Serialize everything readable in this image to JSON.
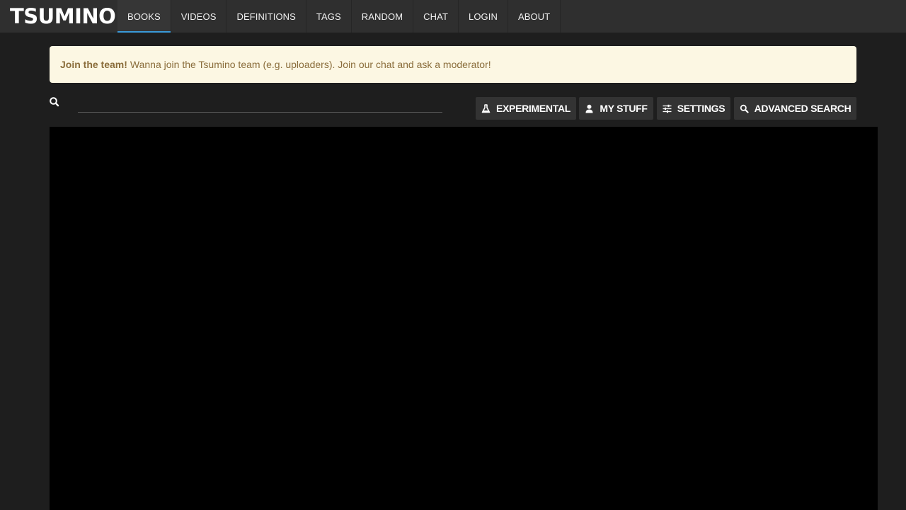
{
  "brand": "TSUMINO",
  "nav": {
    "items": [
      {
        "label": "BOOKS",
        "active": true
      },
      {
        "label": "VIDEOS"
      },
      {
        "label": "DEFINITIONS"
      },
      {
        "label": "TAGS"
      },
      {
        "label": "RANDOM"
      },
      {
        "label": "CHAT"
      },
      {
        "label": "LOGIN"
      },
      {
        "label": "ABOUT"
      }
    ]
  },
  "alert": {
    "title": "Join the team!",
    "message": "Wanna join the Tsumino team (e.g. uploaders). Join our chat and ask a moderator!"
  },
  "search": {
    "icon": "search-icon",
    "value": "",
    "placeholder": ""
  },
  "toolbar": {
    "experimental": {
      "label": "EXPERIMENTAL",
      "icon": "flask-icon"
    },
    "my_stuff": {
      "label": "MY STUFF",
      "icon": "user-icon"
    },
    "settings": {
      "label": "SETTINGS",
      "icon": "sliders-icon"
    },
    "advanced_search": {
      "label": "ADVANCED SEARCH",
      "icon": "search-icon"
    }
  },
  "colors": {
    "nav_bg": "#2f2f2f",
    "page_bg": "#1e1e1e",
    "accent": "#3a9ad9",
    "alert_bg": "#fcf7e3",
    "alert_text": "#8a6d3b",
    "content_bg": "#000000"
  }
}
